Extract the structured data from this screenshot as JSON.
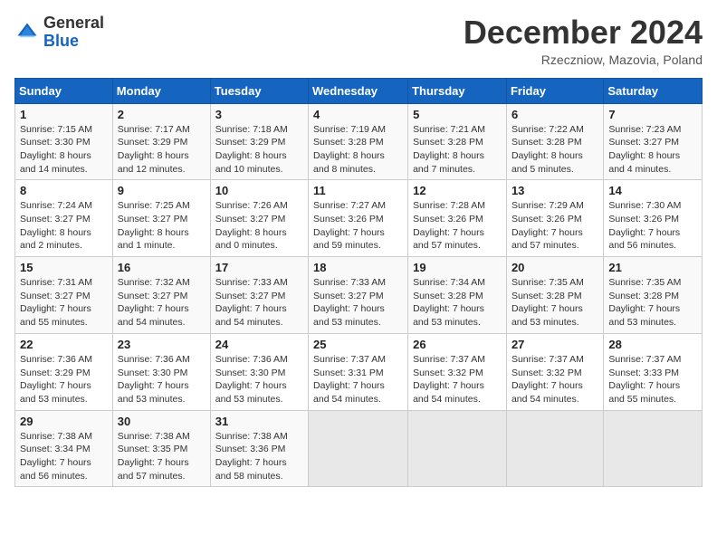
{
  "header": {
    "logo_general": "General",
    "logo_blue": "Blue",
    "month_title": "December 2024",
    "location": "Rzeczniow, Mazovia, Poland"
  },
  "days_of_week": [
    "Sunday",
    "Monday",
    "Tuesday",
    "Wednesday",
    "Thursday",
    "Friday",
    "Saturday"
  ],
  "weeks": [
    [
      {
        "day": 1,
        "lines": [
          "Sunrise: 7:15 AM",
          "Sunset: 3:30 PM",
          "Daylight: 8 hours",
          "and 14 minutes."
        ]
      },
      {
        "day": 2,
        "lines": [
          "Sunrise: 7:17 AM",
          "Sunset: 3:29 PM",
          "Daylight: 8 hours",
          "and 12 minutes."
        ]
      },
      {
        "day": 3,
        "lines": [
          "Sunrise: 7:18 AM",
          "Sunset: 3:29 PM",
          "Daylight: 8 hours",
          "and 10 minutes."
        ]
      },
      {
        "day": 4,
        "lines": [
          "Sunrise: 7:19 AM",
          "Sunset: 3:28 PM",
          "Daylight: 8 hours",
          "and 8 minutes."
        ]
      },
      {
        "day": 5,
        "lines": [
          "Sunrise: 7:21 AM",
          "Sunset: 3:28 PM",
          "Daylight: 8 hours",
          "and 7 minutes."
        ]
      },
      {
        "day": 6,
        "lines": [
          "Sunrise: 7:22 AM",
          "Sunset: 3:28 PM",
          "Daylight: 8 hours",
          "and 5 minutes."
        ]
      },
      {
        "day": 7,
        "lines": [
          "Sunrise: 7:23 AM",
          "Sunset: 3:27 PM",
          "Daylight: 8 hours",
          "and 4 minutes."
        ]
      }
    ],
    [
      {
        "day": 8,
        "lines": [
          "Sunrise: 7:24 AM",
          "Sunset: 3:27 PM",
          "Daylight: 8 hours",
          "and 2 minutes."
        ]
      },
      {
        "day": 9,
        "lines": [
          "Sunrise: 7:25 AM",
          "Sunset: 3:27 PM",
          "Daylight: 8 hours",
          "and 1 minute."
        ]
      },
      {
        "day": 10,
        "lines": [
          "Sunrise: 7:26 AM",
          "Sunset: 3:27 PM",
          "Daylight: 8 hours",
          "and 0 minutes."
        ]
      },
      {
        "day": 11,
        "lines": [
          "Sunrise: 7:27 AM",
          "Sunset: 3:26 PM",
          "Daylight: 7 hours",
          "and 59 minutes."
        ]
      },
      {
        "day": 12,
        "lines": [
          "Sunrise: 7:28 AM",
          "Sunset: 3:26 PM",
          "Daylight: 7 hours",
          "and 57 minutes."
        ]
      },
      {
        "day": 13,
        "lines": [
          "Sunrise: 7:29 AM",
          "Sunset: 3:26 PM",
          "Daylight: 7 hours",
          "and 57 minutes."
        ]
      },
      {
        "day": 14,
        "lines": [
          "Sunrise: 7:30 AM",
          "Sunset: 3:26 PM",
          "Daylight: 7 hours",
          "and 56 minutes."
        ]
      }
    ],
    [
      {
        "day": 15,
        "lines": [
          "Sunrise: 7:31 AM",
          "Sunset: 3:27 PM",
          "Daylight: 7 hours",
          "and 55 minutes."
        ]
      },
      {
        "day": 16,
        "lines": [
          "Sunrise: 7:32 AM",
          "Sunset: 3:27 PM",
          "Daylight: 7 hours",
          "and 54 minutes."
        ]
      },
      {
        "day": 17,
        "lines": [
          "Sunrise: 7:33 AM",
          "Sunset: 3:27 PM",
          "Daylight: 7 hours",
          "and 54 minutes."
        ]
      },
      {
        "day": 18,
        "lines": [
          "Sunrise: 7:33 AM",
          "Sunset: 3:27 PM",
          "Daylight: 7 hours",
          "and 53 minutes."
        ]
      },
      {
        "day": 19,
        "lines": [
          "Sunrise: 7:34 AM",
          "Sunset: 3:28 PM",
          "Daylight: 7 hours",
          "and 53 minutes."
        ]
      },
      {
        "day": 20,
        "lines": [
          "Sunrise: 7:35 AM",
          "Sunset: 3:28 PM",
          "Daylight: 7 hours",
          "and 53 minutes."
        ]
      },
      {
        "day": 21,
        "lines": [
          "Sunrise: 7:35 AM",
          "Sunset: 3:28 PM",
          "Daylight: 7 hours",
          "and 53 minutes."
        ]
      }
    ],
    [
      {
        "day": 22,
        "lines": [
          "Sunrise: 7:36 AM",
          "Sunset: 3:29 PM",
          "Daylight: 7 hours",
          "and 53 minutes."
        ]
      },
      {
        "day": 23,
        "lines": [
          "Sunrise: 7:36 AM",
          "Sunset: 3:30 PM",
          "Daylight: 7 hours",
          "and 53 minutes."
        ]
      },
      {
        "day": 24,
        "lines": [
          "Sunrise: 7:36 AM",
          "Sunset: 3:30 PM",
          "Daylight: 7 hours",
          "and 53 minutes."
        ]
      },
      {
        "day": 25,
        "lines": [
          "Sunrise: 7:37 AM",
          "Sunset: 3:31 PM",
          "Daylight: 7 hours",
          "and 54 minutes."
        ]
      },
      {
        "day": 26,
        "lines": [
          "Sunrise: 7:37 AM",
          "Sunset: 3:32 PM",
          "Daylight: 7 hours",
          "and 54 minutes."
        ]
      },
      {
        "day": 27,
        "lines": [
          "Sunrise: 7:37 AM",
          "Sunset: 3:32 PM",
          "Daylight: 7 hours",
          "and 54 minutes."
        ]
      },
      {
        "day": 28,
        "lines": [
          "Sunrise: 7:37 AM",
          "Sunset: 3:33 PM",
          "Daylight: 7 hours",
          "and 55 minutes."
        ]
      }
    ],
    [
      {
        "day": 29,
        "lines": [
          "Sunrise: 7:38 AM",
          "Sunset: 3:34 PM",
          "Daylight: 7 hours",
          "and 56 minutes."
        ]
      },
      {
        "day": 30,
        "lines": [
          "Sunrise: 7:38 AM",
          "Sunset: 3:35 PM",
          "Daylight: 7 hours",
          "and 57 minutes."
        ]
      },
      {
        "day": 31,
        "lines": [
          "Sunrise: 7:38 AM",
          "Sunset: 3:36 PM",
          "Daylight: 7 hours",
          "and 58 minutes."
        ]
      },
      null,
      null,
      null,
      null
    ]
  ]
}
